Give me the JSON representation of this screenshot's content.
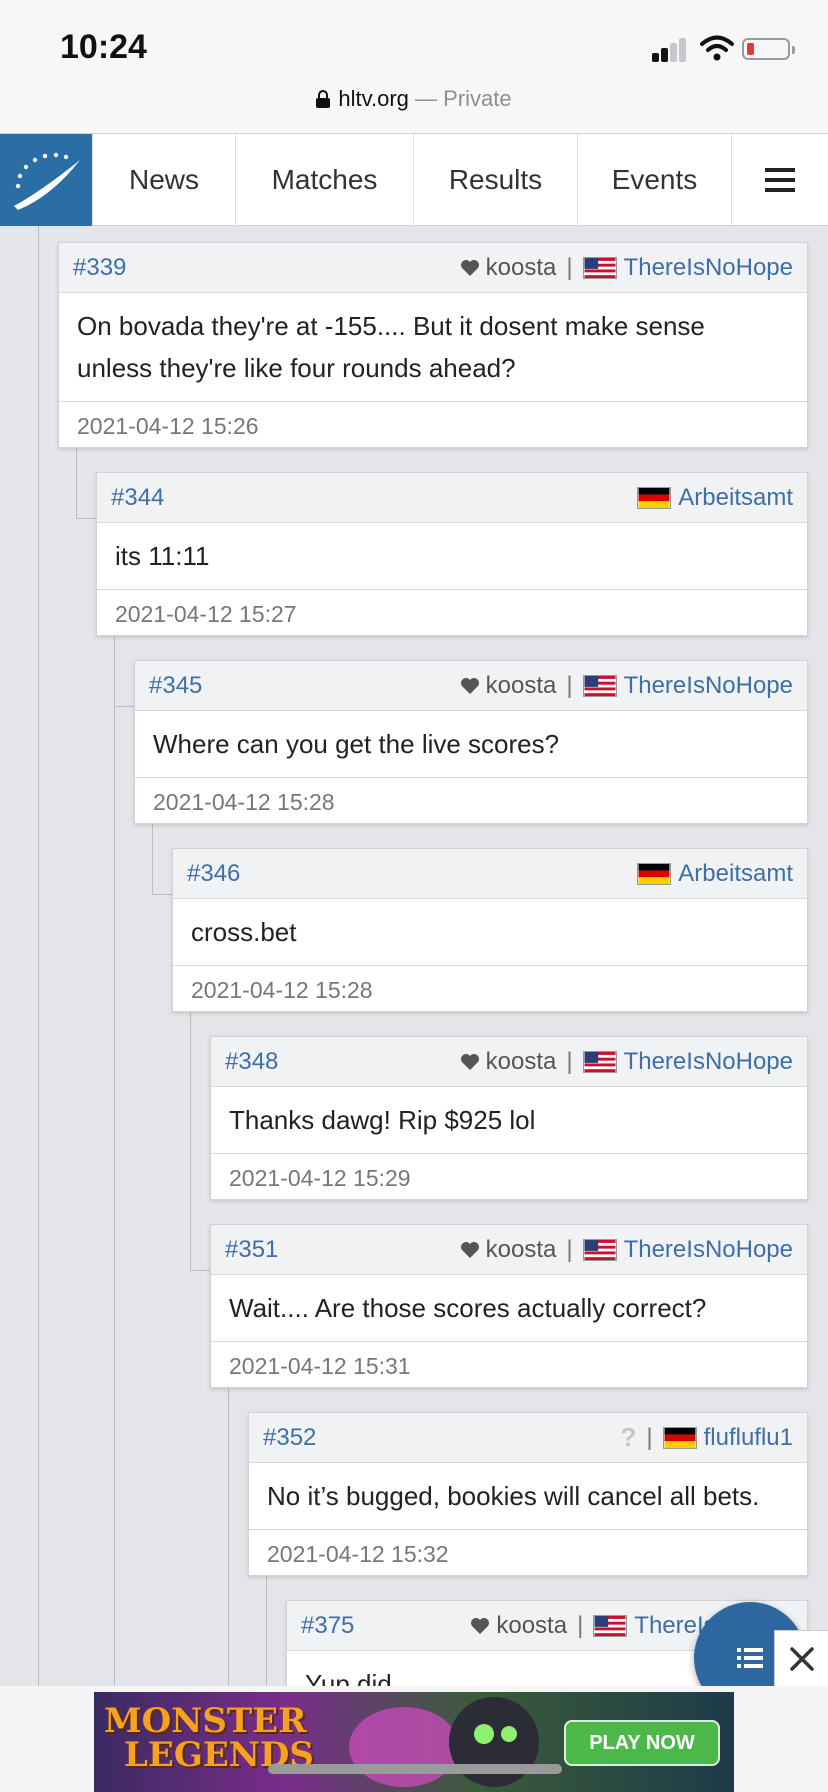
{
  "status_bar": {
    "time": "10:24"
  },
  "browser": {
    "domain": "hltv.org",
    "separator": " — ",
    "mode": "Private"
  },
  "nav": {
    "items": [
      "News",
      "Matches",
      "Results",
      "Events"
    ]
  },
  "posts": [
    {
      "num": "#339",
      "fav": "koosta",
      "user": "ThereIsNoHope",
      "flag": "us",
      "lines": [
        "On bovada they're at -155.... But it dosent make sense",
        "unless they're like four rounds ahead?"
      ],
      "time": "2021-04-12 15:26"
    },
    {
      "num": "#344",
      "user": "Arbeitsamt",
      "flag": "de",
      "lines": [
        "its 11:11"
      ],
      "time": "2021-04-12 15:27"
    },
    {
      "num": "#345",
      "fav": "koosta",
      "user": "ThereIsNoHope",
      "flag": "us",
      "lines": [
        "Where can you get the live scores?"
      ],
      "time": "2021-04-12 15:28"
    },
    {
      "num": "#346",
      "user": "Arbeitsamt",
      "flag": "de",
      "lines": [
        "cross.bet"
      ],
      "time": "2021-04-12 15:28"
    },
    {
      "num": "#348",
      "fav": "koosta",
      "user": "ThereIsNoHope",
      "flag": "us",
      "lines": [
        "Thanks dawg! Rip $925 lol"
      ],
      "time": "2021-04-12 15:29"
    },
    {
      "num": "#351",
      "fav": "koosta",
      "user": "ThereIsNoHope",
      "flag": "us",
      "lines": [
        "Wait.... Are those scores actually correct?"
      ],
      "time": "2021-04-12 15:31"
    },
    {
      "num": "#352",
      "fav": "?",
      "user": "flufluflu1",
      "flag": "de",
      "lines": [
        "No it’s bugged, bookies will cancel all bets."
      ],
      "time": "2021-04-12 15:32"
    },
    {
      "num": "#375",
      "fav": "koosta",
      "user": "ThereIsN",
      "flag": "us",
      "lines": [
        "Yup did"
      ],
      "time": ""
    }
  ],
  "ad": {
    "brand_line1": "MONSTER",
    "brand_line2": "LEGENDS",
    "cta": "PLAY NOW"
  },
  "colors": {
    "brand": "#2b6ea5",
    "link": "#3e6fa5",
    "ad_cta": "#4cb84a"
  }
}
